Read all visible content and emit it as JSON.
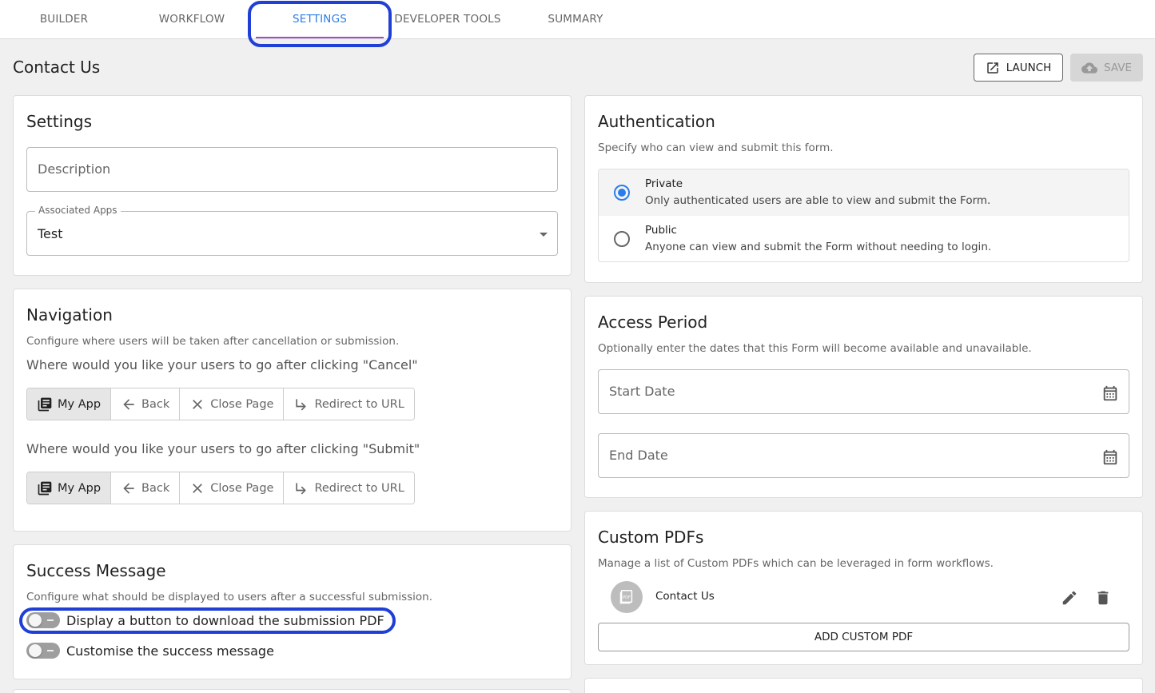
{
  "tabs": [
    {
      "label": "BUILDER",
      "active": false
    },
    {
      "label": "WORKFLOW",
      "active": false
    },
    {
      "label": "SETTINGS",
      "active": true
    },
    {
      "label": "DEVELOPER TOOLS",
      "active": false
    },
    {
      "label": "SUMMARY",
      "active": false
    }
  ],
  "header": {
    "title": "Contact Us",
    "launch_label": "LAUNCH",
    "save_label": "SAVE"
  },
  "settings": {
    "title": "Settings",
    "description_placeholder": "Description",
    "associated_apps_label": "Associated Apps",
    "associated_apps_value": "Test"
  },
  "navigation": {
    "title": "Navigation",
    "subtitle": "Configure where users will be taken after cancellation or submission.",
    "cancel_question": "Where would you like your users to go after clicking \"Cancel\"",
    "submit_question": "Where would you like your users to go after clicking \"Submit\"",
    "options": [
      "My App",
      "Back",
      "Close Page",
      "Redirect to URL"
    ],
    "cancel_selected": "My App",
    "submit_selected": "My App"
  },
  "success": {
    "title": "Success Message",
    "subtitle": "Configure what should be displayed to users after a successful submission.",
    "toggle_pdf_label": "Display a button to download the submission PDF",
    "toggle_pdf_on": false,
    "toggle_custom_label": "Customise the success message",
    "toggle_custom_on": false
  },
  "auth": {
    "title": "Authentication",
    "subtitle": "Specify who can view and submit this form.",
    "options": [
      {
        "title": "Private",
        "desc": "Only authenticated users are able to view and submit the Form.",
        "selected": true
      },
      {
        "title": "Public",
        "desc": "Anyone can view and submit the Form without needing to login.",
        "selected": false
      }
    ]
  },
  "access": {
    "title": "Access Period",
    "subtitle": "Optionally enter the dates that this Form will become available and unavailable.",
    "start_placeholder": "Start Date",
    "end_placeholder": "End Date"
  },
  "pdfs": {
    "title": "Custom PDFs",
    "subtitle": "Manage a list of Custom PDFs which can be leveraged in form workflows.",
    "items": [
      {
        "name": "Contact Us"
      }
    ],
    "avatar_text": "PDF",
    "add_label": "ADD CUSTOM PDF"
  },
  "colors": {
    "accent": "#2b7de9",
    "tab_indicator": "#9c4dcc",
    "annotation": "#1f3fd6"
  }
}
